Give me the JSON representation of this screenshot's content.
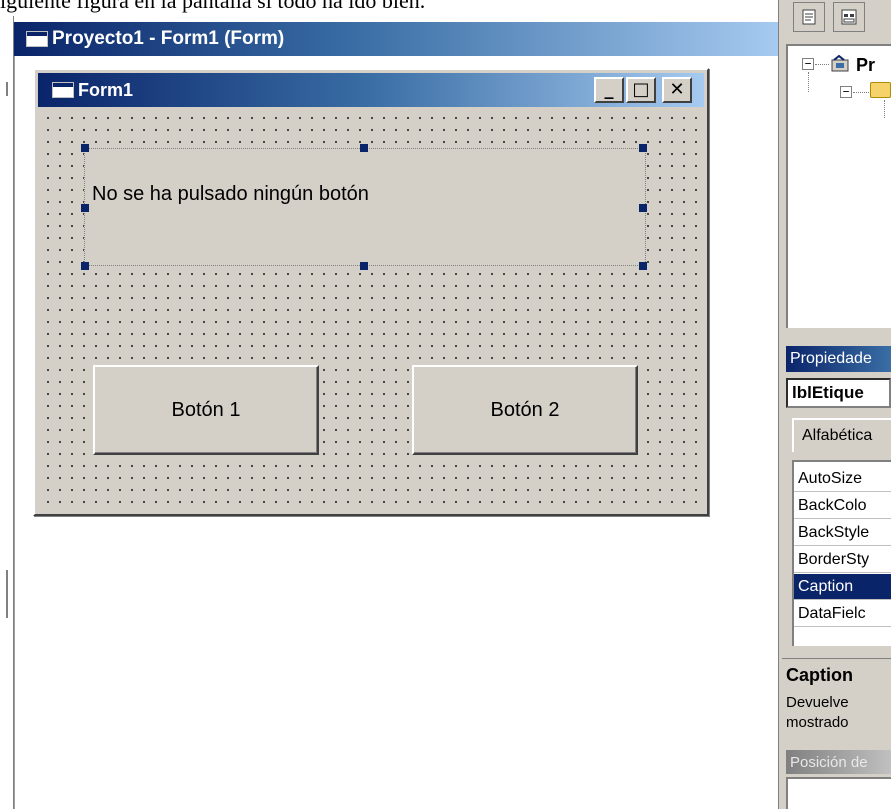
{
  "doc_caption": "iguiente figura en la pantalla si todo ha ido bien.",
  "designer": {
    "title": "Proyecto1 - Form1 (Form)",
    "icon": "form-window-icon"
  },
  "form1": {
    "title": "Form1",
    "icon": "form-window-icon",
    "controls": {
      "minimize_glyph": "_",
      "maximize_glyph": "□",
      "close_glyph": "✕"
    },
    "label_caption": "No se ha pulsado ningún botón",
    "button1": "Botón 1",
    "button2": "Botón 2"
  },
  "project_explorer": {
    "toolbar": [
      "view-code-icon",
      "view-object-icon"
    ],
    "tree_root": "Pr"
  },
  "properties": {
    "title": "Propiedade",
    "object": "lblEtique",
    "tab": "Alfabética",
    "rows": [
      "AutoSize",
      "BackColo",
      "BackStyle",
      "BorderSty",
      "Caption",
      "DataFielc"
    ],
    "selected": "Caption",
    "desc_title": "Caption",
    "desc_text": "Devuelve\nmostrado",
    "position_title": "Posición de"
  },
  "colors": {
    "titlebar_active": "#0a246a",
    "face": "#d4d0c8",
    "selection_handle": "#0a246a"
  }
}
